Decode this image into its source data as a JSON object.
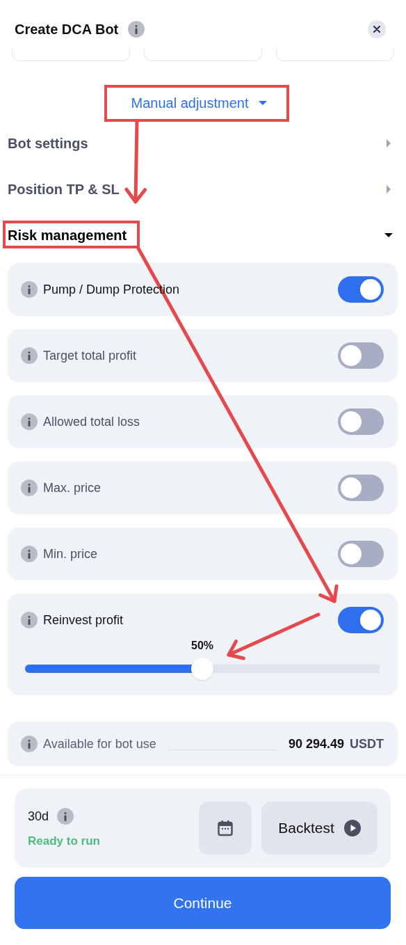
{
  "header": {
    "title": "Create DCA Bot"
  },
  "mode_link": {
    "label": "Manual adjustment",
    "expanded": true
  },
  "sections": [
    {
      "label": "Bot settings",
      "expanded": false
    },
    {
      "label": "Position TP & SL",
      "expanded": false
    },
    {
      "label": "Risk management",
      "expanded": true
    }
  ],
  "risk_settings": [
    {
      "label": "Pump / Dump Protection",
      "on": true
    },
    {
      "label": "Target total profit",
      "on": false
    },
    {
      "label": "Allowed total loss",
      "on": false
    },
    {
      "label": "Max. price",
      "on": false
    },
    {
      "label": "Min. price",
      "on": false
    },
    {
      "label": "Reinvest profit",
      "on": true,
      "slider": {
        "reading": "50%",
        "level": 0.5
      }
    }
  ],
  "available": {
    "label": "Available for bot use",
    "amount": "90 294.49",
    "currency": "USDT"
  },
  "backtest": {
    "period": "30d",
    "status": "Ready to run",
    "button": "Backtest"
  },
  "continue_button": "Continue"
}
